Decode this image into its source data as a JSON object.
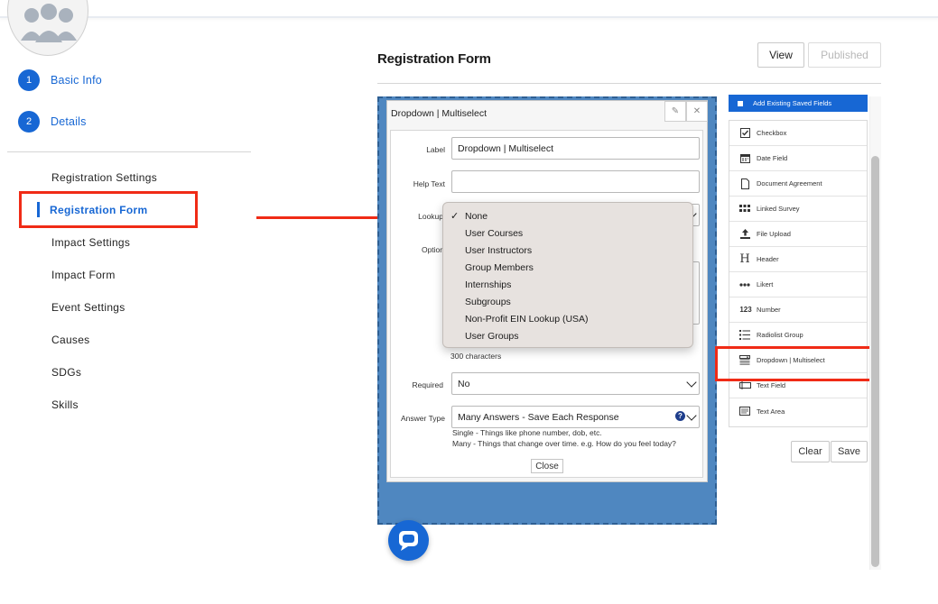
{
  "colors": {
    "accent": "#1767d4",
    "highlight": "#f02b16",
    "canvas": "#4f87c0"
  },
  "steps": [
    {
      "num": "1",
      "label": "Basic Info"
    },
    {
      "num": "2",
      "label": "Details"
    }
  ],
  "nav": {
    "items": [
      "Registration Settings",
      "Registration Form",
      "Impact Settings",
      "Impact Form",
      "Event Settings",
      "Causes",
      "SDGs",
      "Skills"
    ],
    "active": "Registration Form"
  },
  "header": {
    "title": "Registration Form",
    "view_label": "View",
    "published_label": "Published"
  },
  "dialog": {
    "title": "Dropdown | Multiselect",
    "edit_icon": "pencil-icon",
    "close_icon": "x-icon",
    "label_label": "Label",
    "label_value": "Dropdown | Multiselect",
    "help_label": "Help Text",
    "help_value": "",
    "lookup_label": "Lookup",
    "options_label": "Option",
    "char_count": "300 characters",
    "required_label": "Required",
    "required_value": "No",
    "answer_label": "Answer Type",
    "answer_value": "Many Answers - Save Each Response",
    "note_single": "Single - Things like phone number, dob, etc.",
    "note_many": "Many - Things that change over time. e.g. How do you feel today?",
    "close_label": "Close"
  },
  "lookup_dropdown": {
    "selected": "None",
    "options": [
      "None",
      "User Courses",
      "User Instructors",
      "Group Members",
      "Internships",
      "Subgroups",
      "Non-Profit EIN Lookup (USA)",
      "User Groups"
    ]
  },
  "fields_panel": {
    "add_existing": "Add Existing Saved Fields",
    "items": [
      {
        "label": "Checkbox",
        "icon": "checkbox-icon"
      },
      {
        "label": "Date Field",
        "icon": "calendar-icon"
      },
      {
        "label": "Document Agreement",
        "icon": "document-icon"
      },
      {
        "label": "Linked Survey",
        "icon": "grid-icon"
      },
      {
        "label": "File Upload",
        "icon": "upload-icon"
      },
      {
        "label": "Header",
        "icon": "header-icon"
      },
      {
        "label": "Likert",
        "icon": "dots-icon"
      },
      {
        "label": "Number",
        "icon": "number-icon"
      },
      {
        "label": "Radiolist Group",
        "icon": "list-icon"
      },
      {
        "label": "Dropdown | Multiselect",
        "icon": "dropdown-icon"
      },
      {
        "label": "Text Field",
        "icon": "text-field-icon"
      },
      {
        "label": "Text Area",
        "icon": "text-area-icon"
      }
    ],
    "clear_label": "Clear",
    "save_label": "Save"
  },
  "number_icon_text": "123",
  "header_icon_text": "H"
}
